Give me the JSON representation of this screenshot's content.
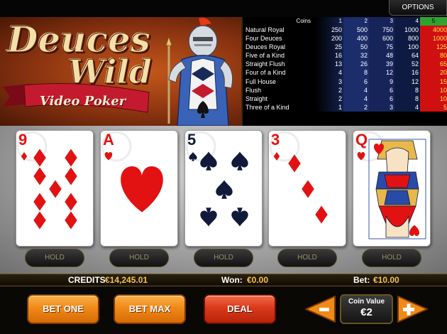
{
  "options": {
    "label": "OPTIONS"
  },
  "logo": {
    "line1": "Deuces",
    "line2": "Wild",
    "subtitle": "Video Poker"
  },
  "paytable": {
    "header": {
      "label": "Coins",
      "cols": [
        "1",
        "2",
        "3",
        "4",
        "5"
      ]
    },
    "rows": [
      {
        "name": "Natural Royal",
        "pays": [
          "250",
          "500",
          "750",
          "1000",
          "4000"
        ]
      },
      {
        "name": "Four Deuces",
        "pays": [
          "200",
          "400",
          "600",
          "800",
          "1000"
        ]
      },
      {
        "name": "Deuces Royal",
        "pays": [
          "25",
          "50",
          "75",
          "100",
          "125"
        ]
      },
      {
        "name": "Five of a Kind",
        "pays": [
          "16",
          "32",
          "48",
          "64",
          "80"
        ]
      },
      {
        "name": "Straight Flush",
        "pays": [
          "13",
          "26",
          "39",
          "52",
          "65"
        ]
      },
      {
        "name": "Four of a Kind",
        "pays": [
          "4",
          "8",
          "12",
          "16",
          "20"
        ]
      },
      {
        "name": "Full House",
        "pays": [
          "3",
          "6",
          "9",
          "12",
          "15"
        ]
      },
      {
        "name": "Flush",
        "pays": [
          "2",
          "4",
          "6",
          "8",
          "10"
        ]
      },
      {
        "name": "Straight",
        "pays": [
          "2",
          "4",
          "6",
          "8",
          "10"
        ]
      },
      {
        "name": "Three of a Kind",
        "pays": [
          "1",
          "2",
          "3",
          "4",
          "5"
        ]
      }
    ],
    "active_col_color": "#d01010",
    "active_header_color": "#2fa32f"
  },
  "cards": [
    {
      "rank": "9",
      "suit": "diamond",
      "color": "red"
    },
    {
      "rank": "A",
      "suit": "heart",
      "color": "red"
    },
    {
      "rank": "5",
      "suit": "spade",
      "color": "black"
    },
    {
      "rank": "3",
      "suit": "diamond",
      "color": "red"
    },
    {
      "rank": "Q",
      "suit": "heart",
      "color": "red"
    }
  ],
  "hold_label": "HOLD",
  "info": {
    "credits_label": "CREDITS",
    "credits_value": "€14,245.01",
    "won_label": "Won:",
    "won_value": "€0.00",
    "bet_label": "Bet:",
    "bet_value": "€10.00"
  },
  "controls": {
    "bet_one": "BET ONE",
    "bet_max": "BET MAX",
    "deal": "DEAL",
    "coin_value_label": "Coin Value",
    "coin_value": "€2"
  },
  "colors": {
    "accent_orange": "#ef8a18",
    "deal_red": "#d83a1a",
    "gold_text": "#f6c24a"
  }
}
